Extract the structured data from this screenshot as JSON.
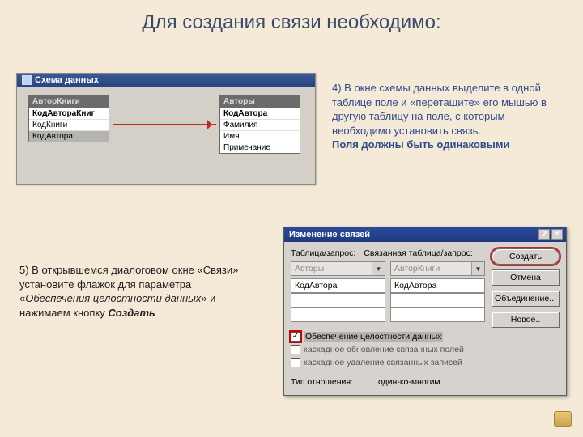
{
  "title": "Для создания связи необходимо:",
  "schema_window": {
    "caption": "Схема данных",
    "table1": {
      "header": "АвторКниги",
      "rows": [
        "КодАвтораКниг",
        "КодКниги",
        "КодАвтора"
      ]
    },
    "table2": {
      "header": "Авторы",
      "rows": [
        "КодАвтора",
        "Фамилия",
        "Имя",
        "Примечание"
      ]
    }
  },
  "step4": {
    "text": "4) В окне схемы данных выделите в одной таблице поле и «перетащите» его мышью в другую таблицу на поле, с которым необходимо установить связь.",
    "bold": "Поля должны быть одинаковыми"
  },
  "step5": {
    "p1": "5) В открывшемся диалоговом окне «Связи» установите флажок для параметра «",
    "em": "Обеспечения целостности данных",
    "p2": "» и нажимаем кнопку ",
    "btn": "Создать"
  },
  "dialog": {
    "caption": "Изменение связей",
    "label_table": "Таблица/запрос:",
    "label_linked": "Связанная таблица/запрос:",
    "combo1": "Авторы",
    "combo2": "АвторКниги",
    "field1": "КодАвтора",
    "field2": "КодАвтора",
    "buttons": {
      "create": "Создать",
      "cancel": "Отмена",
      "join": "Объединение...",
      "new": "Новое.."
    },
    "chk_integrity": "Обеспечение целостности данных",
    "chk_cascade_update": "каскадное обновление связанных полей",
    "chk_cascade_delete": "каскадное удаление связанных записей",
    "reltype_label": "Тип отношения:",
    "reltype_value": "один-ко-многим"
  }
}
